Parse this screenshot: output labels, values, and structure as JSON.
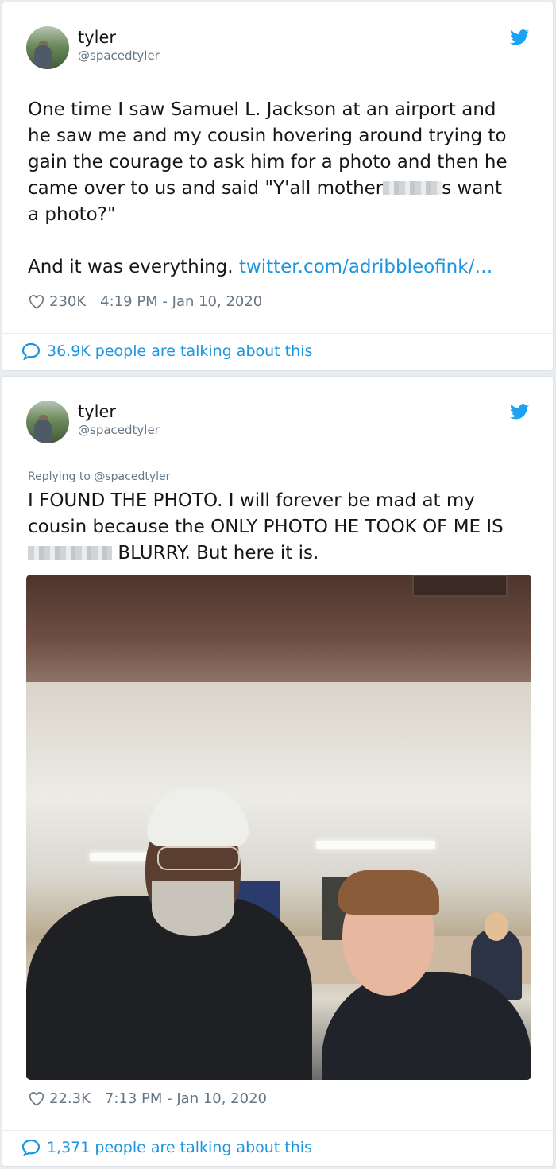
{
  "tweets": [
    {
      "user": {
        "name": "tyler",
        "handle": "@spacedtyler"
      },
      "text_lines": [
        "One time I saw Samuel L. Jackson at an airport and",
        "he saw me and my cousin hovering around trying to",
        "gain the courage to ask him for a photo and then he",
        "came over to us and said \"Y'all mother",
        "s want",
        "a photo?\""
      ],
      "text_line_end": "And it was everything. ",
      "link": "twitter.com/adribbleofink/…",
      "likes": "230K",
      "timestamp": "4:19 PM - Jan 10, 2020",
      "talking": "36.9K people are talking about this"
    },
    {
      "user": {
        "name": "tyler",
        "handle": "@spacedtyler"
      },
      "replying": "Replying to @spacedtyler",
      "text_lines": [
        "I FOUND THE PHOTO. I will forever be mad at my",
        "cousin because the ONLY PHOTO HE TOOK OF ME IS",
        "BLURRY. But here it is."
      ],
      "likes": "22.3K",
      "timestamp": "7:13 PM - Jan 10, 2020",
      "talking": "1,371 people are talking about this"
    }
  ],
  "icons": {
    "bird": "twitter-bird-icon",
    "heart": "heart-icon",
    "bubble": "speech-bubble-icon"
  },
  "colors": {
    "accent": "#1b95e0",
    "muted": "#657786",
    "text": "#14171a"
  }
}
